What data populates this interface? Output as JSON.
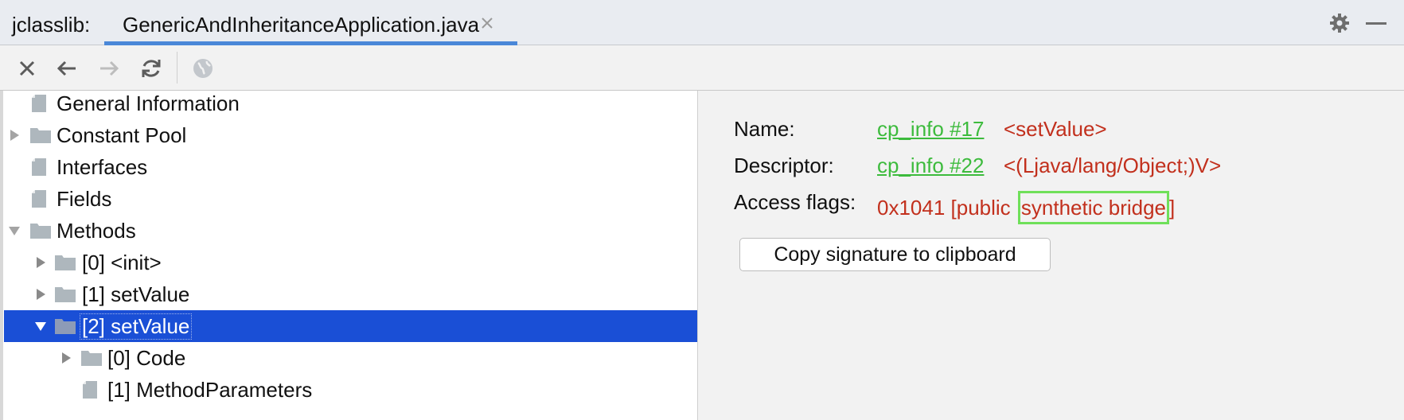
{
  "titlebar": {
    "app_label": "jclasslib:",
    "tab_label": "GenericAndInheritanceApplication.java",
    "icons": {
      "tab_close": "close-icon",
      "settings": "gear-icon",
      "minimize": "minimize-icon"
    }
  },
  "toolbar": {
    "buttons": [
      "close-icon",
      "back-arrow-icon",
      "forward-arrow-icon",
      "refresh-icon",
      "globe-icon"
    ]
  },
  "tree": {
    "items": [
      {
        "label": "General Information",
        "kind": "file",
        "depth": 0,
        "expander": "none"
      },
      {
        "label": "Constant Pool",
        "kind": "folder",
        "depth": 0,
        "expander": "collapsed"
      },
      {
        "label": "Interfaces",
        "kind": "file",
        "depth": 0,
        "expander": "none"
      },
      {
        "label": "Fields",
        "kind": "file",
        "depth": 0,
        "expander": "none"
      },
      {
        "label": "Methods",
        "kind": "folder",
        "depth": 0,
        "expander": "expanded"
      },
      {
        "label": "[0] <init>",
        "kind": "folder",
        "depth": 1,
        "expander": "collapsed"
      },
      {
        "label": "[1] setValue",
        "kind": "folder",
        "depth": 1,
        "expander": "collapsed"
      },
      {
        "label": "[2] setValue",
        "kind": "folder",
        "depth": 1,
        "expander": "expanded",
        "selected": true
      },
      {
        "label": "[0] Code",
        "kind": "folder",
        "depth": 2,
        "expander": "collapsed"
      },
      {
        "label": "[1] MethodParameters",
        "kind": "file",
        "depth": 2,
        "expander": "none"
      }
    ],
    "colors": {
      "selection": "#1a4fd6",
      "icon": "#aeb7bd"
    }
  },
  "detail": {
    "name_label": "Name:",
    "name_link": "cp_info #17",
    "name_value": "<setValue>",
    "descriptor_label": "Descriptor:",
    "descriptor_link": "cp_info #22",
    "descriptor_value": "<(Ljava/lang/Object;)V>",
    "access_label": "Access flags:",
    "access_prefix": "0x1041 [public ",
    "access_highlighted": "synthetic bridge",
    "access_suffix": "]",
    "copy_button": "Copy signature to clipboard",
    "colors": {
      "link": "#3dbb3d",
      "value": "#c2301d",
      "highlight_box": "#6fe05a"
    }
  }
}
